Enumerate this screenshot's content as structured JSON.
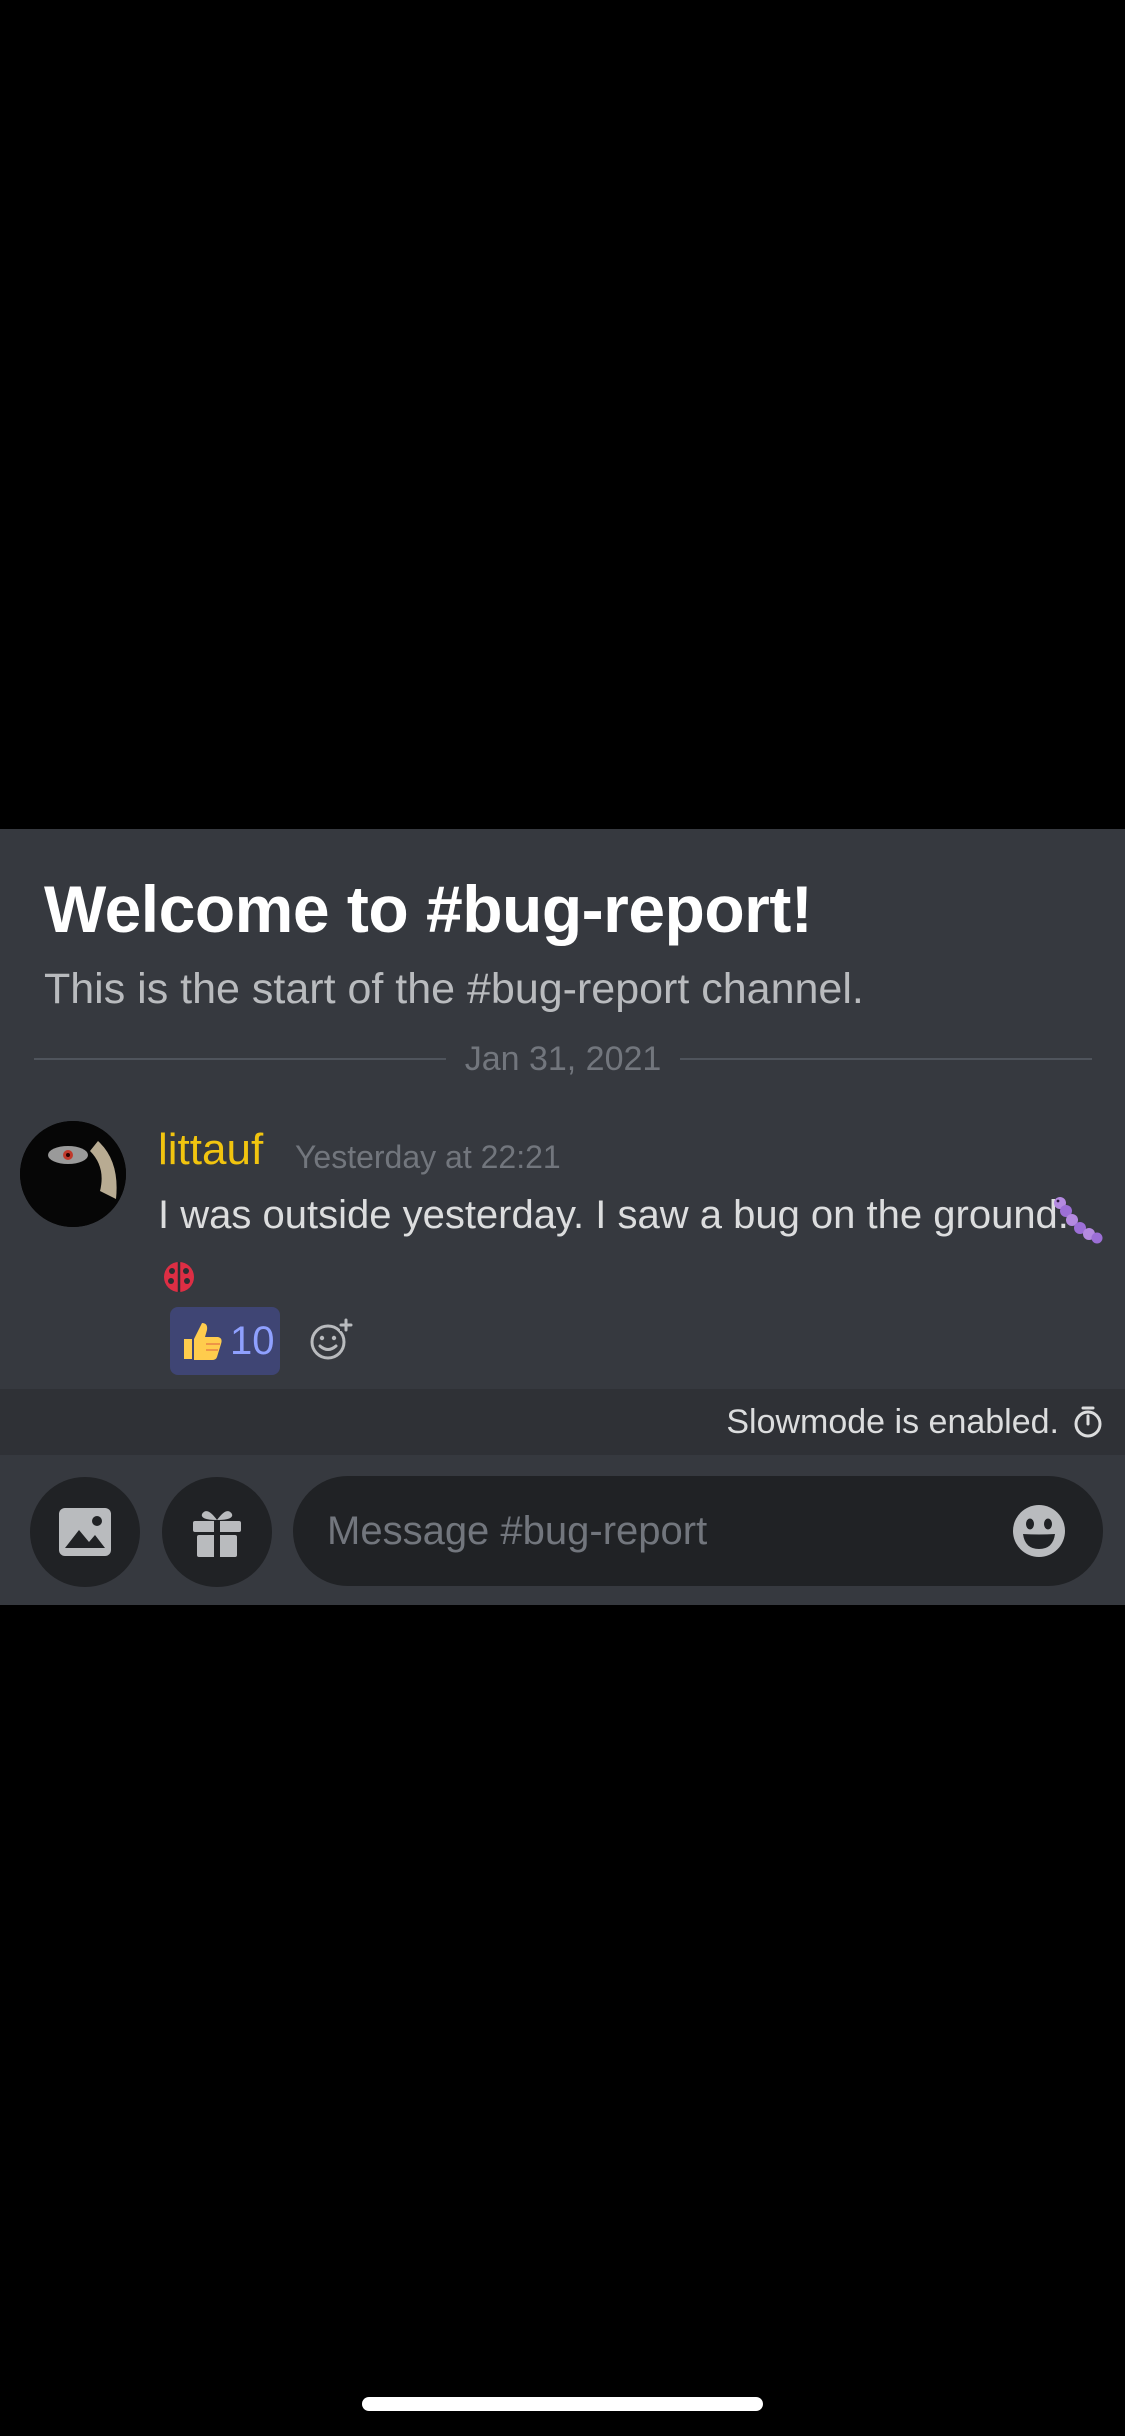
{
  "channel": {
    "welcome_title": "Welcome to #bug-report!",
    "welcome_subtitle": "This is the start of the #bug-report channel.",
    "date_divider": "Jan 31, 2021"
  },
  "message": {
    "author": "littauf",
    "author_color": "#f1c40f",
    "timestamp": "Yesterday at 22:21",
    "text": "I was outside yesterday. I saw a bug on the ground.",
    "inline_emojis": [
      "worm-emoji",
      "ladybug-emoji"
    ],
    "reaction": {
      "emoji": "thumbs-up-icon",
      "count": "10"
    }
  },
  "slowmode": {
    "text": "Slowmode is enabled."
  },
  "composer": {
    "placeholder": "Message #bug-report"
  },
  "colors": {
    "background": "#36393f",
    "accent": "#8fa0ff",
    "reaction_bg": "#3f4574",
    "input_bg": "#202225"
  }
}
